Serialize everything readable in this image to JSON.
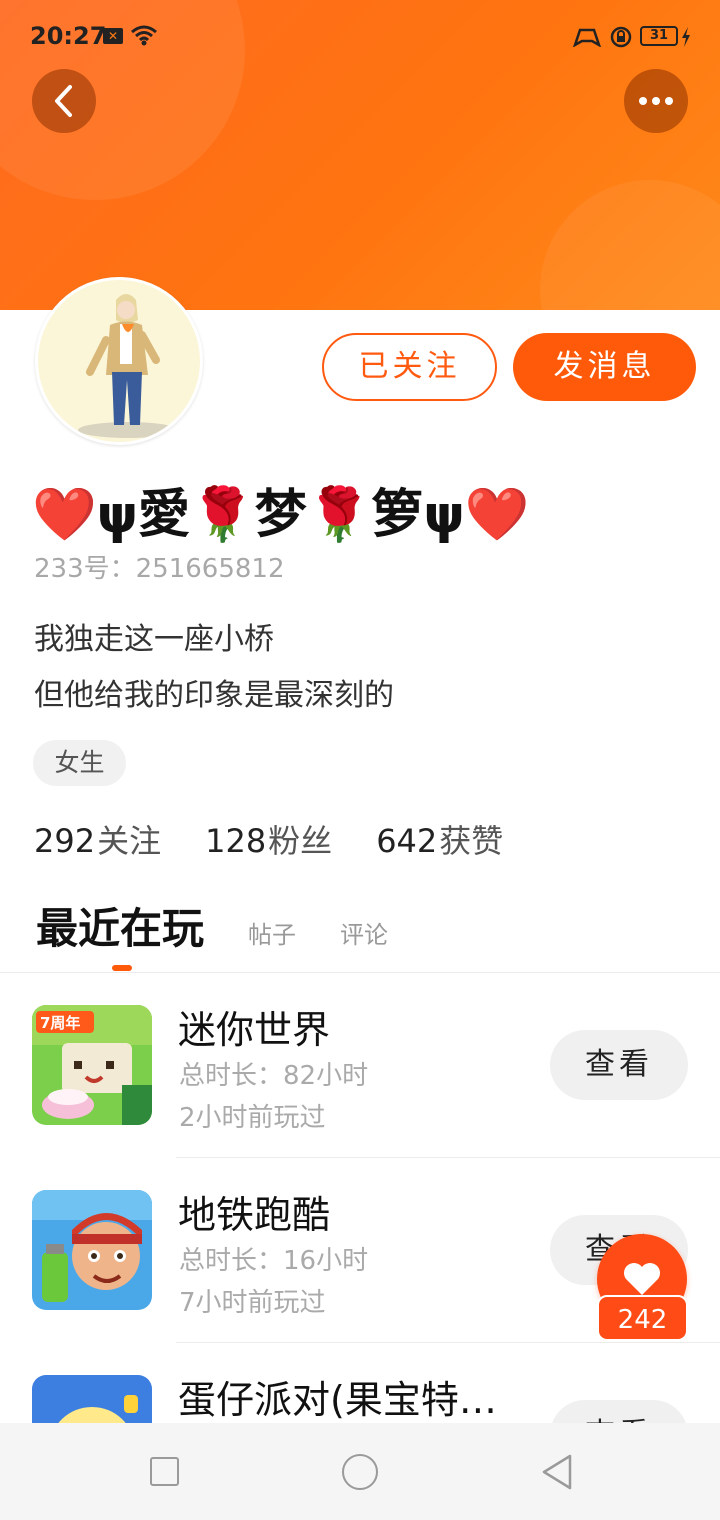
{
  "status_bar": {
    "time": "20:27",
    "battery": "31"
  },
  "profile": {
    "nickname": "❤️ψ愛🌹梦🌹箩ψ❤️",
    "uid": "233号：251665812",
    "bio_line1": "我独走这一座小桥",
    "bio_line2": "但他给我的印象是最深刻的",
    "gender": "女生"
  },
  "actions": {
    "followed_label": "已关注",
    "message_label": "发消息"
  },
  "stats": {
    "following_count": "292",
    "following_label": "关注",
    "fans_count": "128",
    "fans_label": "粉丝",
    "likes_count": "642",
    "likes_label": "获赞"
  },
  "tabs": {
    "active": "最近在玩",
    "posts": "帖子",
    "comments": "评论"
  },
  "games": [
    {
      "name": "迷你世界",
      "total_time": "总时长：82小时",
      "last_played": "2小时前玩过",
      "button": "查看",
      "icon": "mini-world-icon"
    },
    {
      "name": "地铁跑酷",
      "total_time": "总时长：16小时",
      "last_played": "7小时前玩过",
      "button": "查看",
      "icon": "subway-surfers-icon"
    },
    {
      "name": "蛋仔派对(果宝特…",
      "total_time": "",
      "last_played": "",
      "button": "查看",
      "icon": "eggy-party-icon"
    }
  ],
  "like_fab": {
    "count": "242"
  },
  "colors": {
    "accent": "#ff5a0a",
    "header": "#ff7410",
    "like": "#ff4c16"
  }
}
